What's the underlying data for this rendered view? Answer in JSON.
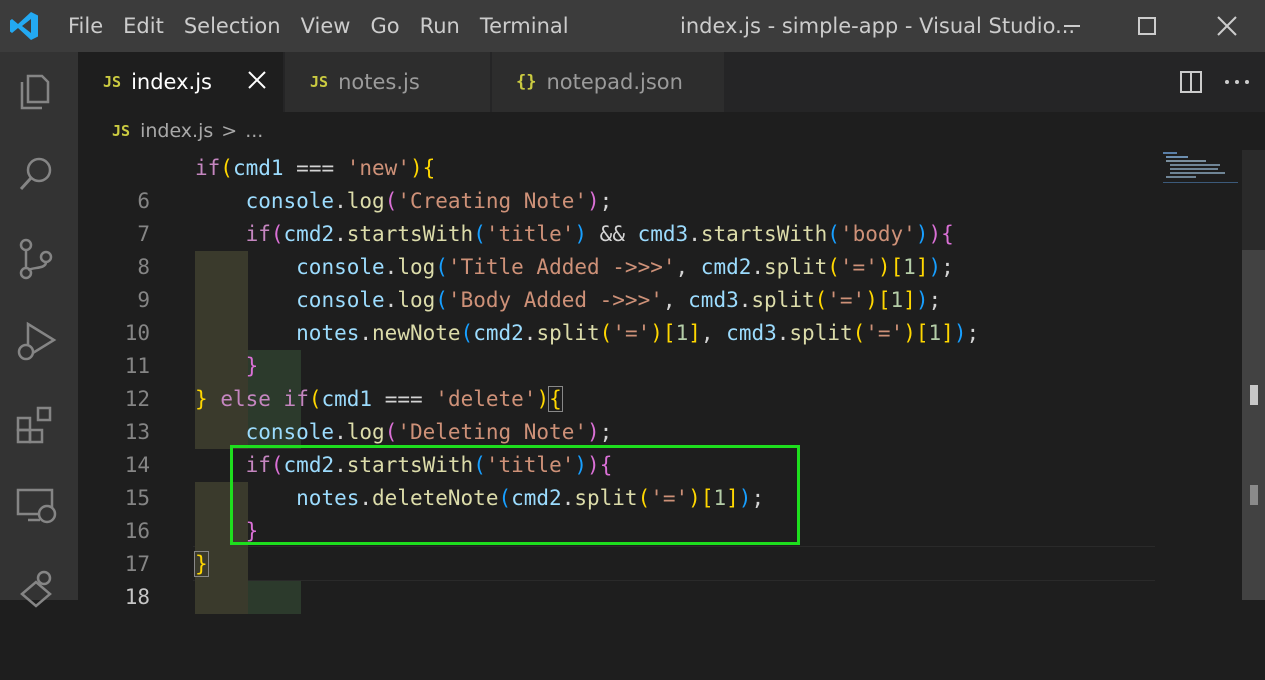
{
  "titlebar": {
    "menu": [
      "File",
      "Edit",
      "Selection",
      "View",
      "Go",
      "Run",
      "Terminal"
    ],
    "window_title": "index.js - simple-app - Visual Studio..."
  },
  "tabs": [
    {
      "badge": "JS",
      "label": "index.js",
      "active": true
    },
    {
      "badge": "JS",
      "label": "notes.js",
      "active": false
    },
    {
      "badge": "{}",
      "label": "notepad.json",
      "active": false
    }
  ],
  "breadcrumb": {
    "badge": "JS",
    "file": "index.js",
    "separator": ">",
    "more": "..."
  },
  "editor": {
    "line_numbers": [
      "6",
      "7",
      "8",
      "9",
      "10",
      "11",
      "12",
      "13",
      "14",
      "15",
      "16",
      "17",
      "18"
    ],
    "current_line": "18"
  },
  "colors": {
    "keyword": "#c586c0",
    "variable": "#9cdcfe",
    "function": "#dcdcaa",
    "string": "#ce9178",
    "number": "#b5cea8",
    "highlight_box": "#1ede1e",
    "js_icon": "#cbcb41"
  }
}
